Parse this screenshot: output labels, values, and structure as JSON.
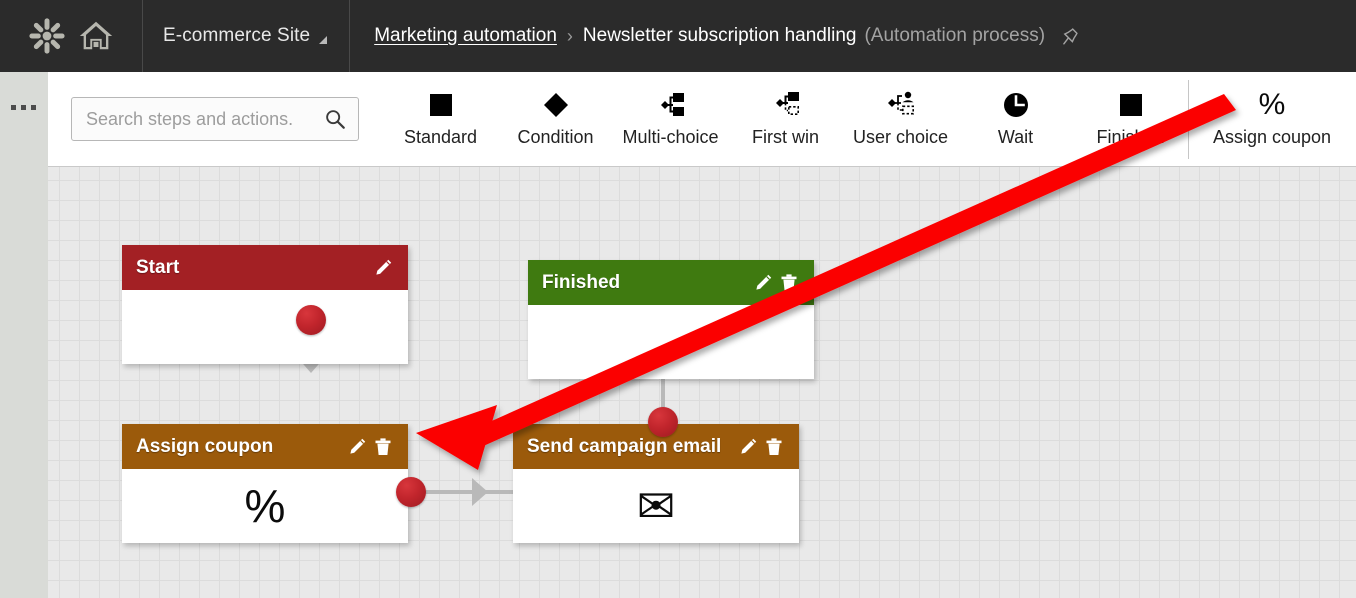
{
  "header": {
    "logo_icon": "asterisk-flower-logo",
    "home_icon": "home-icon",
    "site_name": "E-commerce Site",
    "breadcrumb_link": "Marketing automation",
    "breadcrumb_separator": "›",
    "breadcrumb_current": "Newsletter subscription handling",
    "breadcrumb_type": "(Automation process)",
    "pin_icon": "pin-icon",
    "background_color": "#2B2B2B"
  },
  "rail": {
    "more_icon": "ellipsis-icon",
    "background_color": "#D9DBD7"
  },
  "search": {
    "placeholder": "Search steps and actions.",
    "value": "",
    "icon": "search-icon"
  },
  "toolbar": {
    "items": [
      {
        "label": "Standard",
        "icon": "filled-square-icon"
      },
      {
        "label": "Condition",
        "icon": "filled-diamond-icon"
      },
      {
        "label": "Multi-choice",
        "icon": "multi-choice-icon"
      },
      {
        "label": "First win",
        "icon": "first-win-icon"
      },
      {
        "label": "User choice",
        "icon": "user-choice-icon"
      },
      {
        "label": "Wait",
        "icon": "clock-icon"
      },
      {
        "label": "Finished",
        "icon": "filled-square-icon"
      },
      {
        "label": "Assign coupon",
        "icon": "percent-icon"
      }
    ],
    "divider_before_index": 7
  },
  "canvas": {
    "grid_color": "#DCDCDC",
    "background_color": "#E9E9E9",
    "nodes": [
      {
        "name": "Start",
        "header_color": "#A32024",
        "glyph": "",
        "actions": [
          "edit-icon"
        ]
      },
      {
        "name": "Finished",
        "header_color": "#3F7A10",
        "glyph": "",
        "actions": [
          "edit-icon",
          "delete-icon"
        ]
      },
      {
        "name": "Assign coupon",
        "header_color": "#9B5A0B",
        "glyph": "%",
        "actions": [
          "edit-icon",
          "delete-icon"
        ]
      },
      {
        "name": "Send campaign email",
        "header_color": "#9B5A0B",
        "glyph": "✉",
        "actions": [
          "edit-icon",
          "delete-icon"
        ]
      }
    ],
    "connector_color": "#B9B9B9",
    "connector_dot_color": "#C1252C"
  },
  "annotation": {
    "arrow_color": "#FB0606",
    "from_label": "Assign coupon",
    "to_label": "Assign coupon node"
  }
}
